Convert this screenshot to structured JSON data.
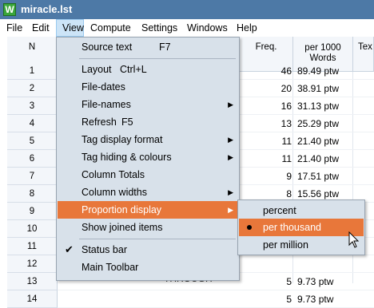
{
  "window": {
    "title": "miracle.lst",
    "icon_letter": "W"
  },
  "menubar": {
    "items": [
      {
        "label": "File"
      },
      {
        "label": "Edit"
      },
      {
        "label": "View"
      },
      {
        "label": "Compute"
      },
      {
        "label": "Settings"
      },
      {
        "label": "Windows"
      },
      {
        "label": "Help"
      }
    ]
  },
  "table": {
    "headers": {
      "n": "N",
      "freq": "Freq.",
      "per1000_line1": "per 1000",
      "per1000_line2": "Words",
      "text": "Tex"
    },
    "rows": [
      {
        "n": "1",
        "freq": "46",
        "per1000": "89.49 ptw"
      },
      {
        "n": "2",
        "freq": "20",
        "per1000": "38.91 ptw"
      },
      {
        "n": "3",
        "freq": "16",
        "per1000": "31.13 ptw"
      },
      {
        "n": "4",
        "freq": "13",
        "per1000": "25.29 ptw"
      },
      {
        "n": "5",
        "freq": "11",
        "per1000": "21.40 ptw"
      },
      {
        "n": "6",
        "freq": "11",
        "per1000": "21.40 ptw"
      },
      {
        "n": "7",
        "freq": "9",
        "per1000": "17.51 ptw"
      },
      {
        "n": "8",
        "freq": "8",
        "per1000": "15.56 ptw"
      },
      {
        "n": "9",
        "freq": "8",
        "per1000": "15.56 ptw"
      },
      {
        "n": "10",
        "freq": "",
        "per1000": ""
      },
      {
        "n": "11",
        "freq": "",
        "per1000": ""
      },
      {
        "n": "12",
        "freq": "",
        "per1000": ""
      },
      {
        "n": "13",
        "freq": "5",
        "per1000": "9.73 ptw"
      },
      {
        "n": "14",
        "freq": "5",
        "per1000": "9.73 ptw"
      }
    ],
    "partial_word": "THROUGH"
  },
  "view_menu": {
    "source_text": {
      "label": "Source text",
      "shortcut": "F7"
    },
    "layout": {
      "label": "Layout",
      "shortcut": "Ctrl+L"
    },
    "file_dates": {
      "label": "File-dates"
    },
    "file_names": {
      "label": "File-names"
    },
    "refresh": {
      "label": "Refresh",
      "shortcut": "F5"
    },
    "tag_display_format": {
      "label": "Tag display format"
    },
    "tag_hiding": {
      "label": "Tag hiding & colours"
    },
    "column_totals": {
      "label": "Column Totals"
    },
    "column_widths": {
      "label": "Column widths"
    },
    "proportion_display": {
      "label": "Proportion display"
    },
    "show_joined_items": {
      "label": "Show joined items"
    },
    "status_bar": {
      "label": "Status bar",
      "checked": true
    },
    "main_toolbar": {
      "label": "Main Toolbar"
    }
  },
  "proportion_submenu": {
    "items": [
      {
        "label": "percent"
      },
      {
        "label": "per thousand",
        "selected": true
      },
      {
        "label": "per million"
      }
    ]
  },
  "colors": {
    "titlebar": "#4d79a6",
    "highlight": "#e8773a",
    "menu_bg": "#d8e1ea"
  }
}
